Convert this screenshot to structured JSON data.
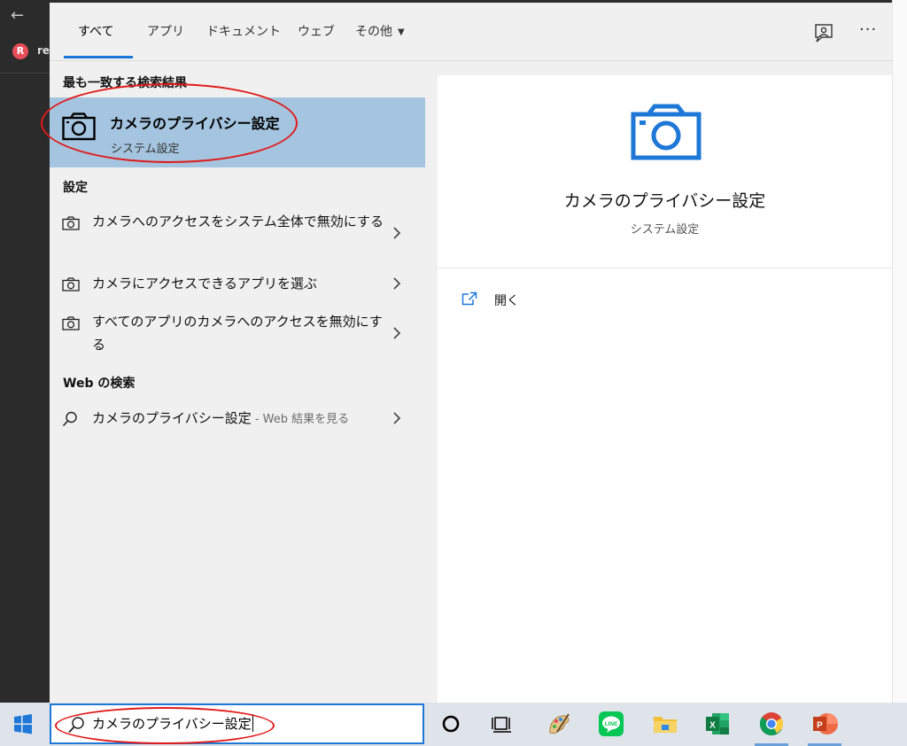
{
  "tabs": {
    "all": "すべて",
    "apps": "アプリ",
    "documents": "ドキュメント",
    "web": "ウェブ",
    "more": "その他"
  },
  "sections": {
    "best_match": "最も一致する検索結果",
    "settings": "設定",
    "web_search": "Web の検索"
  },
  "best_match": {
    "title": "カメラのプライバシー設定",
    "subtitle": "システム設定"
  },
  "settings_items": [
    {
      "label": "カメラへのアクセスをシステム全体で無効にする"
    },
    {
      "label": "カメラにアクセスできるアプリを選ぶ"
    },
    {
      "label": "すべてのアプリのカメラへのアクセスを無効にする"
    }
  ],
  "web_result": {
    "label": "カメラのプライバシー設定",
    "suffix": " - Web 結果を見る"
  },
  "preview": {
    "title": "カメラのプライバシー設定",
    "subtitle": "システム設定",
    "open_label": "開く"
  },
  "search": {
    "value": "カメラのプライバシー設定"
  },
  "background_app": {
    "text": "re"
  },
  "colors": {
    "accent": "#1e78d7",
    "selected": "#a4c4e0",
    "annotation": "#e11a1a"
  }
}
